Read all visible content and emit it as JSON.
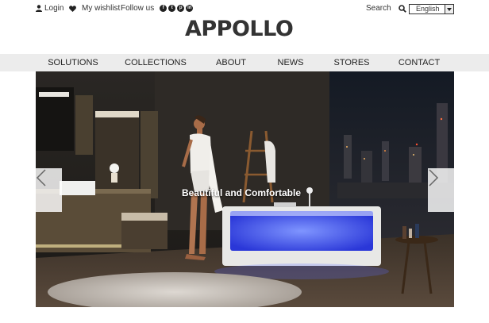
{
  "topbar": {
    "login_label": "Login",
    "wishlist_label": "My wishlist",
    "follow_label": "Follow us",
    "social_icons": [
      "facebook-icon",
      "twitter-icon",
      "pinterest-icon",
      "linkedin-icon"
    ],
    "search_label": "Search",
    "language": "English"
  },
  "logo": {
    "text": "APPOLLO"
  },
  "nav": {
    "items": [
      "SOLUTIONS",
      "COLLECTIONS",
      "ABOUT",
      "NEWS",
      "STORES",
      "CONTACT"
    ]
  },
  "hero": {
    "caption": "Beautiful and Comfortable"
  },
  "colors": {
    "nav_bg": "#ececec",
    "text": "#222222",
    "tub_light": "#4a62ff"
  }
}
